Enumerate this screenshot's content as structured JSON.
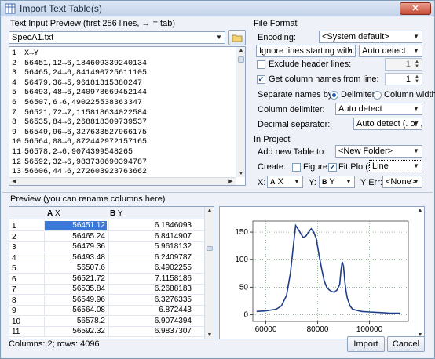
{
  "window": {
    "title": "Import Text Table(s)",
    "close": "✕"
  },
  "preview_top": {
    "label": "Text Input Preview (first 256 lines, → = tab)",
    "file": "SpecA1.txt",
    "lines": [
      {
        "n": "1",
        "t": "X→Y"
      },
      {
        "n": "2",
        "t": "56451,12→6,184609339240134"
      },
      {
        "n": "3",
        "t": "56465,24→6,841490725611105"
      },
      {
        "n": "4",
        "t": "56479,36→5,96181315380247"
      },
      {
        "n": "5",
        "t": "56493,48→6,240978669452144"
      },
      {
        "n": "6",
        "t": "56507,6→6,490225538363347"
      },
      {
        "n": "7",
        "t": "56521,72→7,115818634022584"
      },
      {
        "n": "8",
        "t": "56535,84→6,268818309739537"
      },
      {
        "n": "9",
        "t": "56549,96→6,327633527966175"
      },
      {
        "n": "10",
        "t": "56564,08→6,872442972157165"
      },
      {
        "n": "11",
        "t": "56578,2→6,9074399548265"
      },
      {
        "n": "12",
        "t": "56592,32→6,983730690394787"
      },
      {
        "n": "13",
        "t": "56606,44→6,272603923763662"
      }
    ]
  },
  "file_format": {
    "label": "File Format",
    "encoding_label": "Encoding:",
    "encoding_value": "<System default>",
    "ignore_label": "Ignore lines starting with:",
    "ignore_value": "Auto detect",
    "exclude_header_label": "Exclude header lines:",
    "exclude_header_value": "1",
    "colnames_label": "Get column names from line:",
    "colnames_value": "1",
    "separate_label": "Separate names by:",
    "delimiter_label": "Delimiter",
    "colwidth_label": "Column width",
    "col_delim_label": "Column delimiter:",
    "col_delim_value": "Auto detect",
    "decimal_label": "Decimal separator:",
    "decimal_value": "Auto detect (. or ,)"
  },
  "in_project": {
    "label": "In Project",
    "add_table_label": "Add new Table to:",
    "add_table_value": "<New Folder>",
    "create_label": "Create:",
    "figure_label": "Figure",
    "fitplot_label": "Fit Plot(s)",
    "plot_type_value": "Line",
    "x_label": "X:",
    "x_value": "X",
    "y_label": "Y:",
    "y_value": "Y",
    "yerr_label": "Y Err:",
    "yerr_value": "<None>"
  },
  "preview_bottom": {
    "label": "Preview (you can rename columns here)",
    "col_a": "X",
    "col_b": "Y",
    "rows": [
      {
        "n": "1",
        "x": "56451.12",
        "y": "6.1846093"
      },
      {
        "n": "2",
        "x": "56465.24",
        "y": "6.8414907"
      },
      {
        "n": "3",
        "x": "56479.36",
        "y": "5.9618132"
      },
      {
        "n": "4",
        "x": "56493.48",
        "y": "6.2409787"
      },
      {
        "n": "5",
        "x": "56507.6",
        "y": "6.4902255"
      },
      {
        "n": "6",
        "x": "56521.72",
        "y": "7.1158186"
      },
      {
        "n": "7",
        "x": "56535.84",
        "y": "6.2688183"
      },
      {
        "n": "8",
        "x": "56549.96",
        "y": "6.3276335"
      },
      {
        "n": "9",
        "x": "56564.08",
        "y": "6.872443"
      },
      {
        "n": "10",
        "x": "56578.2",
        "y": "6.9074394"
      },
      {
        "n": "11",
        "x": "56592.32",
        "y": "6.9837307"
      }
    ]
  },
  "chart_data": {
    "type": "line",
    "xlim": [
      55000,
      115000
    ],
    "ylim": [
      -12,
      170
    ],
    "x_ticks": [
      "60000",
      "80000",
      "100000"
    ],
    "y_ticks": [
      "0",
      "50",
      "100",
      "150"
    ],
    "series": [
      {
        "x": [
          56451,
          60000,
          64000,
          66000,
          68000,
          69500,
          70500,
          71500,
          72500,
          73500,
          74500,
          75500,
          76500,
          77500,
          78500,
          79500,
          80500,
          81500,
          82500,
          83500,
          84500,
          85500,
          86500,
          87500,
          88500,
          89000,
          89500,
          90000,
          90500,
          91000,
          91500,
          92500,
          93500,
          95000,
          97000,
          100000,
          104000,
          108000,
          112000
        ],
        "y": [
          6,
          7,
          10,
          16,
          35,
          75,
          120,
          162,
          155,
          147,
          140,
          143,
          150,
          156,
          150,
          138,
          110,
          85,
          62,
          50,
          45,
          42,
          41,
          45,
          55,
          80,
          96,
          88,
          60,
          42,
          30,
          16,
          10,
          8,
          6,
          5,
          4,
          3,
          3
        ]
      }
    ],
    "grid": true,
    "line_color": "#1f3c88"
  },
  "status": {
    "text": "Columns: 2; rows: 4096"
  },
  "buttons": {
    "import": "Import",
    "cancel": "Cancel"
  }
}
